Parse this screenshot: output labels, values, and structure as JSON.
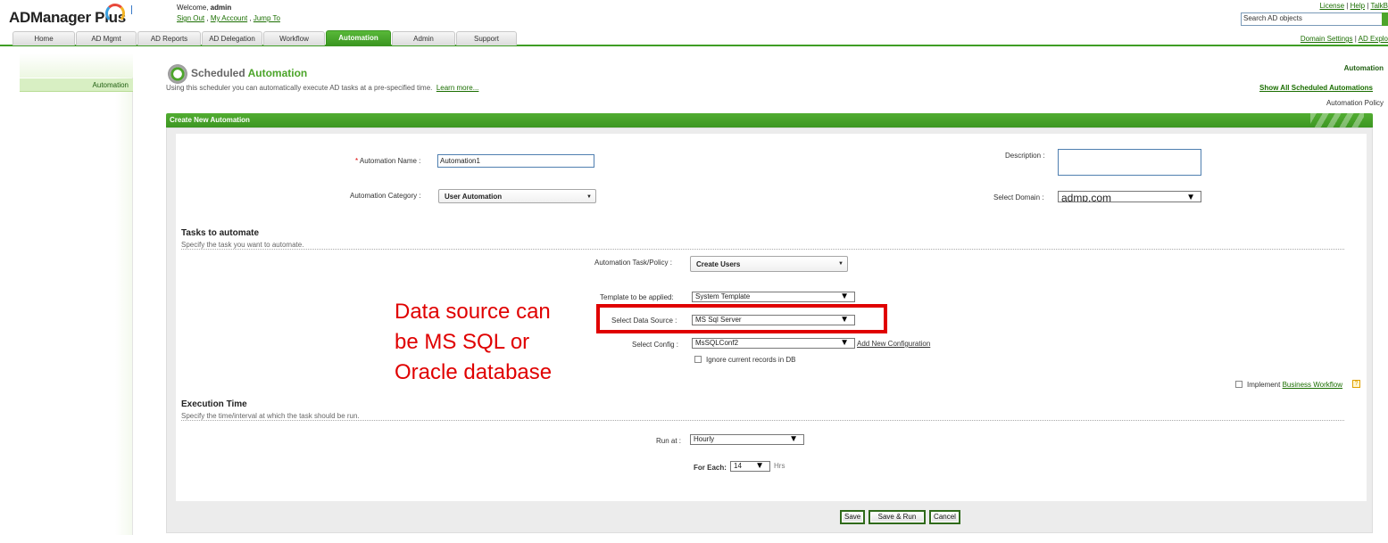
{
  "header": {
    "logo": "ADManager Plus",
    "welcome_prefix": "Welcome,",
    "user": "admin",
    "links": [
      "Sign Out",
      "My Account",
      "Jump To"
    ],
    "top_links": [
      "License",
      "Help",
      "TalkB"
    ],
    "search_placeholder": "Search AD objects",
    "right_links": [
      "Domain Settings",
      "AD Explo"
    ]
  },
  "tabs": [
    "Home",
    "AD Mgmt",
    "AD Reports",
    "AD Delegation",
    "Workflow",
    "Automation",
    "Admin",
    "Support"
  ],
  "active_tab": "Automation",
  "sidebar": {
    "title": "Automation",
    "items": [
      "Automation",
      "Automation Policy"
    ]
  },
  "page": {
    "title_prefix": "Scheduled",
    "title_accent": "Automation",
    "description": "Using this scheduler you can automatically execute AD tasks at a pre-specified time.",
    "learn_more": "Learn more...",
    "show_all": "Show All Scheduled Automations"
  },
  "form": {
    "panel_title": "Create New Automation",
    "name_label": "Automation Name :",
    "name_value": "Automation1",
    "category_label": "Automation Category :",
    "category_value": "User Automation",
    "description_label": "Description :",
    "domain_label": "Select Domain :",
    "domain_value": "admp.com",
    "tasks_title": "Tasks to automate",
    "tasks_desc": "Specify the task you want to automate.",
    "task_label": "Automation Task/Policy :",
    "task_value": "Create Users",
    "template_label": "Template to be applied:",
    "template_value": "System Template",
    "datasource_label": "Select Data Source :",
    "datasource_value": "MS Sql Server",
    "config_label": "Select Config :",
    "config_value": "MsSQLConf2",
    "add_config": "Add New Configuration",
    "ignore_label": "Ignore current records in DB",
    "workflow_label": "Implement",
    "workflow_link": "Business Workflow",
    "exec_title": "Execution Time",
    "exec_desc": "Specify the time/interval at which the task should be run.",
    "runat_label": "Run at :",
    "runat_value": "Hourly",
    "foreach_label": "For Each:",
    "foreach_value": "14",
    "foreach_unit": "Hrs"
  },
  "annotation": "Data source can be MS SQL or Oracle database",
  "buttons": [
    "Save",
    "Save & Run",
    "Cancel"
  ],
  "colors": {
    "accent": "#4ca52a",
    "highlight": "#e00000"
  }
}
